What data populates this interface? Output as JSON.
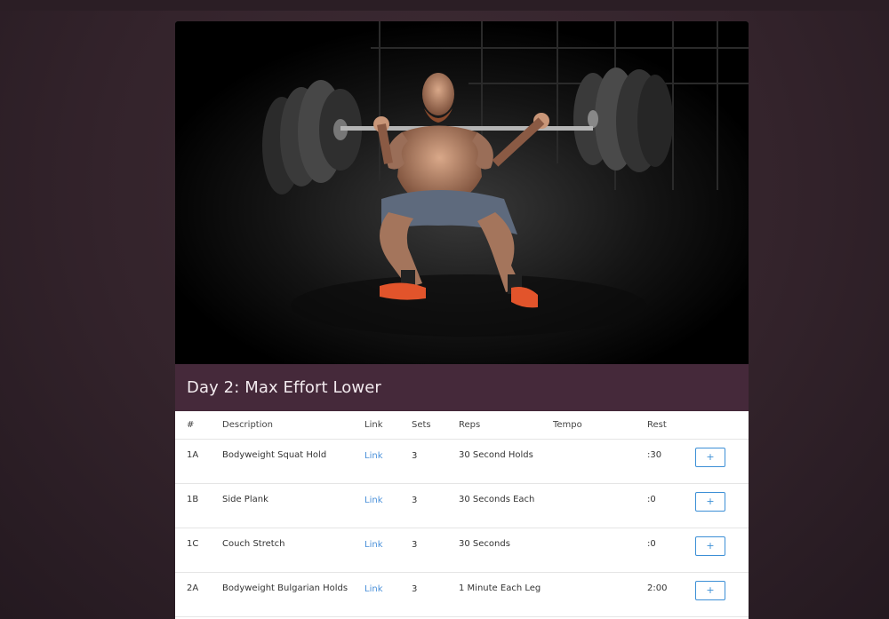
{
  "workout": {
    "title": "Day 2: Max Effort Lower"
  },
  "table": {
    "headers": {
      "num": "#",
      "description": "Description",
      "link": "Link",
      "sets": "Sets",
      "reps": "Reps",
      "tempo": "Tempo",
      "rest": "Rest"
    },
    "rows": [
      {
        "num": "1A",
        "description": "Bodyweight Squat Hold",
        "link": "Link",
        "sets": "3",
        "reps": "30 Second Holds",
        "tempo": "",
        "rest": ":30",
        "button": "+"
      },
      {
        "num": "1B",
        "description": "Side Plank",
        "link": "Link",
        "sets": "3",
        "reps": "30 Seconds Each",
        "tempo": "",
        "rest": ":0",
        "button": "+"
      },
      {
        "num": "1C",
        "description": "Couch Stretch",
        "link": "Link",
        "sets": "3",
        "reps": "30 Seconds",
        "tempo": "",
        "rest": ":0",
        "button": "+"
      },
      {
        "num": "2A",
        "description": "Bodyweight Bulgarian Holds",
        "link": "Link",
        "sets": "3",
        "reps": "1 Minute Each Leg",
        "tempo": "",
        "rest": "2:00",
        "button": "+"
      }
    ]
  },
  "colors": {
    "title_bar": "#45293a",
    "link": "#4a90d9",
    "button_border": "#3c8fd6"
  }
}
